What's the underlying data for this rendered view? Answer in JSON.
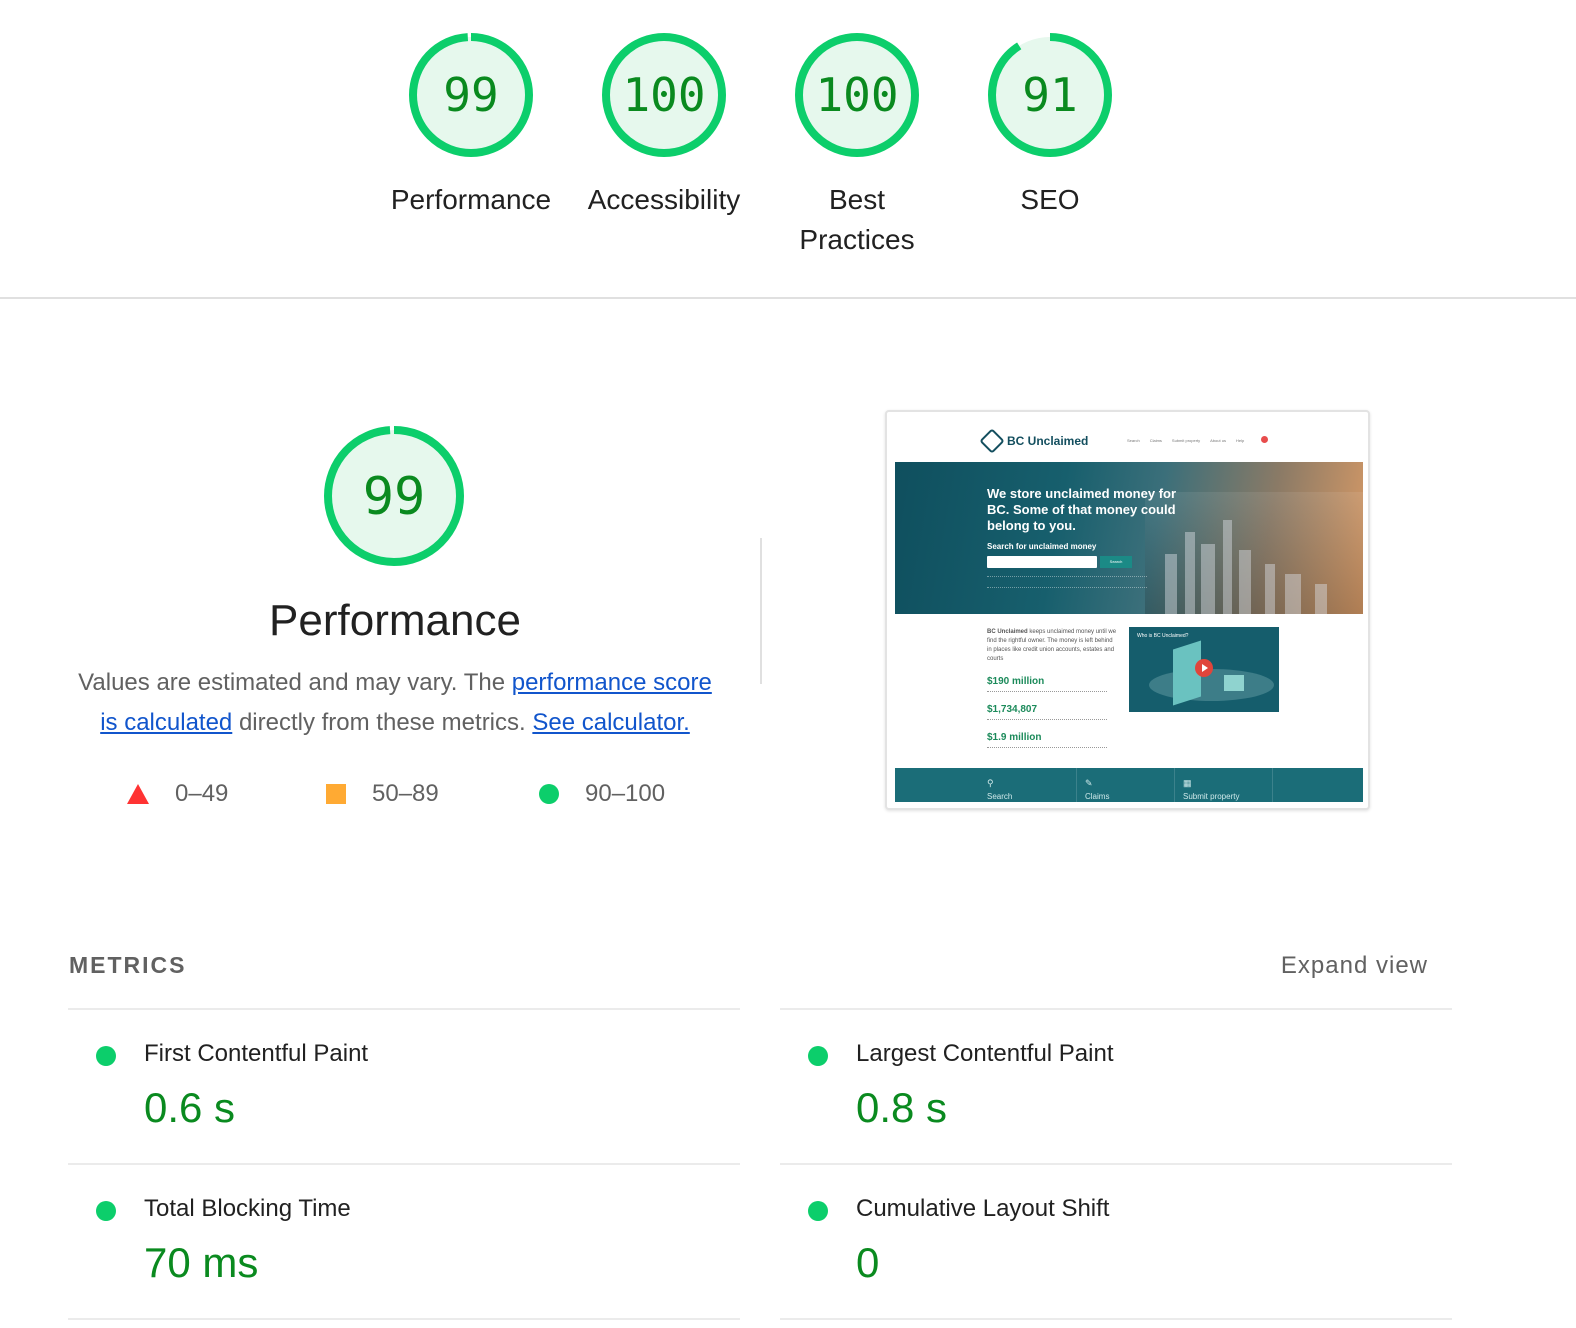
{
  "colors": {
    "pass": "#0cce6b",
    "pass_text": "#0a8a1f",
    "pass_fill": "#e6f8ed",
    "average": "#ffaa33",
    "fail": "#ff3333",
    "link": "#1155cc"
  },
  "categories": [
    {
      "score": "99",
      "label": "Performance",
      "fraction": 0.99
    },
    {
      "score": "100",
      "label": "Accessibility",
      "fraction": 1.0
    },
    {
      "score": "100",
      "label": "Best Practices",
      "fraction": 1.0
    },
    {
      "score": "91",
      "label": "SEO",
      "fraction": 0.91
    }
  ],
  "performance": {
    "score": "99",
    "fraction": 0.99,
    "title": "Performance",
    "desc_prefix": "Values are estimated and may vary. The ",
    "link_score": "performance score is calculated",
    "desc_middle": " directly from these metrics. ",
    "link_calculator": "See calculator.",
    "legend": [
      {
        "icon": "triangle-fail-icon",
        "range": "0–49"
      },
      {
        "icon": "square-average-icon",
        "range": "50–89"
      },
      {
        "icon": "circle-pass-icon",
        "range": "90–100"
      }
    ]
  },
  "screenshot": {
    "brand": "BC Unclaimed",
    "nav": [
      "Search",
      "Claims",
      "Submit property",
      "About us",
      "Help"
    ],
    "hero_title": "We store unclaimed money for BC. Some of that money could belong to you.",
    "hero_search_label": "Search for unclaimed money",
    "hero_button": "Search",
    "body_brand": "BC Unclaimed",
    "body_text": " keeps unclaimed money until we find the rightful owner. The money is left behind in places like credit union accounts, estates and courts",
    "stats": [
      "$190 million",
      "$1,734,807",
      "$1.9 million"
    ],
    "video_label": "Who is BC Unclaimed?",
    "footer": [
      "Search",
      "Claims",
      "Submit property"
    ]
  },
  "metrics": {
    "heading": "METRICS",
    "expand_label": "Expand view",
    "items": [
      {
        "title": "First Contentful Paint",
        "value": "0.6 s"
      },
      {
        "title": "Largest Contentful Paint",
        "value": "0.8 s"
      },
      {
        "title": "Total Blocking Time",
        "value": "70 ms"
      },
      {
        "title": "Cumulative Layout Shift",
        "value": "0"
      }
    ]
  }
}
